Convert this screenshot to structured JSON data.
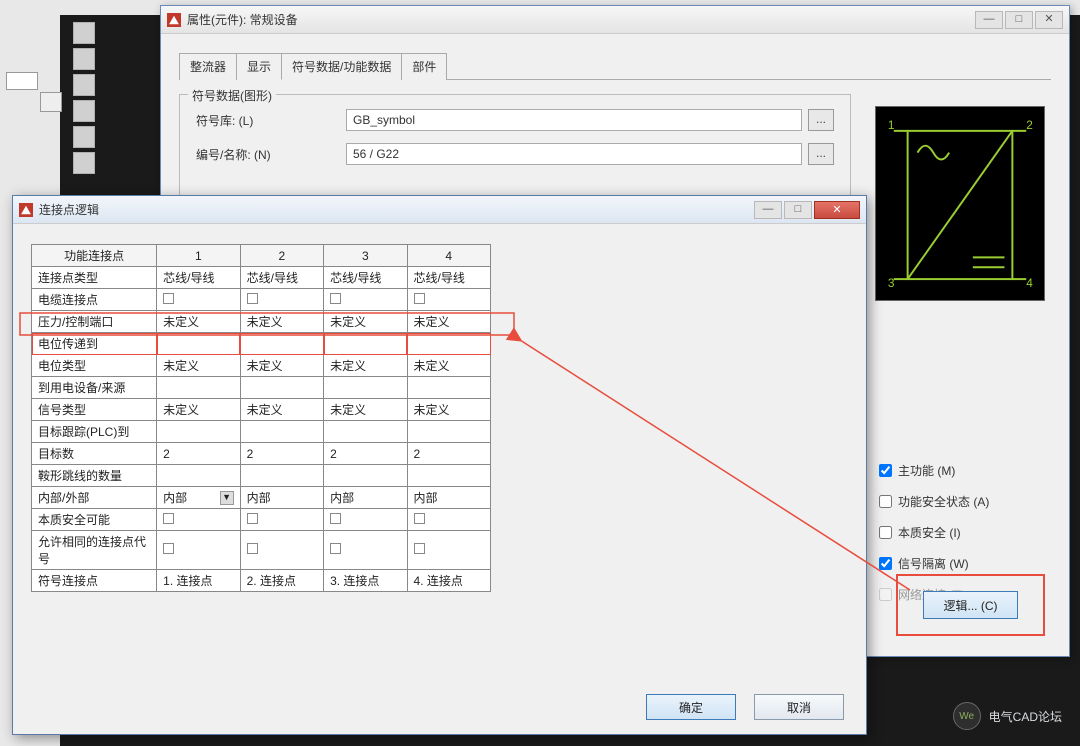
{
  "mainDialog": {
    "title": "属性(元件): 常规设备",
    "tabs": [
      "整流器",
      "显示",
      "符号数据/功能数据",
      "部件"
    ],
    "activeTab": 2,
    "group": {
      "legend": "符号数据(图形)",
      "rows": [
        {
          "label": "符号库: (L)",
          "value": "GB_symbol"
        },
        {
          "label": "编号/名称: (N)",
          "value": "56 / G22"
        }
      ]
    },
    "checks": [
      {
        "label": "主功能 (M)",
        "checked": true,
        "disabled": false
      },
      {
        "label": "功能安全状态 (A)",
        "checked": false,
        "disabled": false
      },
      {
        "label": "本质安全 (I)",
        "checked": false,
        "disabled": false
      },
      {
        "label": "信号隔离 (W)",
        "checked": true,
        "disabled": false
      },
      {
        "label": "网络连接 (T)",
        "checked": false,
        "disabled": true
      }
    ],
    "logicBtn": "逻辑... (C)",
    "winbtns": {
      "min": "—",
      "max": "□",
      "close": "✕"
    },
    "browse": "..."
  },
  "childDialog": {
    "title": "连接点逻辑",
    "headers": [
      "功能连接点",
      "1",
      "2",
      "3",
      "4"
    ],
    "rows": [
      {
        "label": "连接点类型",
        "cells": [
          "芯线/导线",
          "芯线/导线",
          "芯线/导线",
          "芯线/导线"
        ]
      },
      {
        "label": "电缆连接点",
        "type": "checkbox"
      },
      {
        "label": "压力/控制端口",
        "cells": [
          "未定义",
          "未定义",
          "未定义",
          "未定义"
        ]
      },
      {
        "label": "电位传递到",
        "cells": [
          "",
          "",
          "",
          ""
        ],
        "highlight": true
      },
      {
        "label": "电位类型",
        "cells": [
          "未定义",
          "未定义",
          "未定义",
          "未定义"
        ]
      },
      {
        "label": "到用电设备/来源",
        "cells": [
          "",
          "",
          "",
          ""
        ]
      },
      {
        "label": "信号类型",
        "cells": [
          "未定义",
          "未定义",
          "未定义",
          "未定义"
        ]
      },
      {
        "label": "目标跟踪(PLC)到",
        "cells": [
          "",
          "",
          "",
          ""
        ]
      },
      {
        "label": "目标数",
        "cells": [
          "2",
          "2",
          "2",
          "2"
        ]
      },
      {
        "label": "鞍形跳线的数量",
        "cells": [
          "",
          "",
          "",
          ""
        ]
      },
      {
        "label": "内部/外部",
        "cells": [
          "内部",
          "内部",
          "内部",
          "内部"
        ],
        "dropdown": 0
      },
      {
        "label": "本质安全可能",
        "type": "checkbox"
      },
      {
        "label": "允许相同的连接点代号",
        "type": "checkbox"
      },
      {
        "label": "符号连接点",
        "cells": [
          "1. 连接点",
          "2. 连接点",
          "3. 连接点",
          "4. 连接点"
        ]
      }
    ],
    "ok": "确定",
    "cancel": "取消",
    "winbtns": {
      "min": "—",
      "max": "□",
      "close": "✕"
    }
  },
  "preview": {
    "p1": "1",
    "p2": "2",
    "p3": "3",
    "p4": "4"
  },
  "watermark": "电气CAD论坛"
}
